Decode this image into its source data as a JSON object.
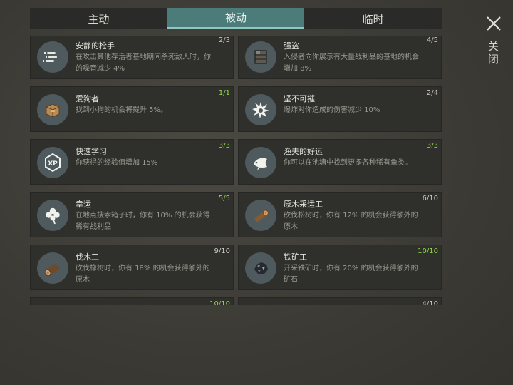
{
  "tabs": [
    "主动",
    "被动",
    "临时"
  ],
  "close_label": "关闭",
  "perks": [
    {
      "title": "安静的枪手",
      "desc": "在攻击其他存活者基地期间杀死敌人时，你的噪音减少 4%",
      "level": "2/3",
      "max": false,
      "icon": "bullets-icon"
    },
    {
      "title": "强盗",
      "desc": "入侵者向你展示有大量战利品的基地的机会增加 8%",
      "level": "4/5",
      "max": false,
      "icon": "crate-icon"
    },
    {
      "title": "爱狗者",
      "desc": "找到小狗的机会将提升 5%。",
      "level": "1/1",
      "max": true,
      "icon": "dog-crate-icon"
    },
    {
      "title": "坚不可摧",
      "desc": "爆炸对你造成的伤害减少 10%",
      "level": "2/4",
      "max": false,
      "icon": "explosion-icon"
    },
    {
      "title": "快速学习",
      "desc": "你获得的经验值增加 15%",
      "level": "3/3",
      "max": true,
      "icon": "xp-icon"
    },
    {
      "title": "渔夫的好运",
      "desc": "你可以在池塘中找到更多各种稀有鱼类。",
      "level": "3/3",
      "max": true,
      "icon": "fish-icon"
    },
    {
      "title": "幸运",
      "desc": "在地点搜索箱子时，你有 10% 的机会获得稀有战利品",
      "level": "5/5",
      "max": true,
      "icon": "clover-icon"
    },
    {
      "title": "原木采运工",
      "desc": "砍伐松树时，你有 12% 的机会获得额外的原木",
      "level": "6/10",
      "max": false,
      "icon": "pine-log-icon"
    },
    {
      "title": "伐木工",
      "desc": "砍伐橡树时，你有 18% 的机会获得额外的原木",
      "level": "9/10",
      "max": false,
      "icon": "oak-log-icon"
    },
    {
      "title": "铁矿工",
      "desc": "开采铁矿时，你有 20% 的机会获得额外的矿石",
      "level": "10/10",
      "max": true,
      "icon": "iron-ore-icon"
    },
    {
      "title": "",
      "desc": "",
      "level": "10/10",
      "max": true,
      "icon": "partial-icon"
    },
    {
      "title": "",
      "desc": "",
      "level": "4/10",
      "max": false,
      "icon": "partial-icon"
    }
  ],
  "colors": {
    "accent_tab": "#4b7c7a",
    "max_level": "#8fd84a",
    "card_bg": "#2f2f2c"
  }
}
